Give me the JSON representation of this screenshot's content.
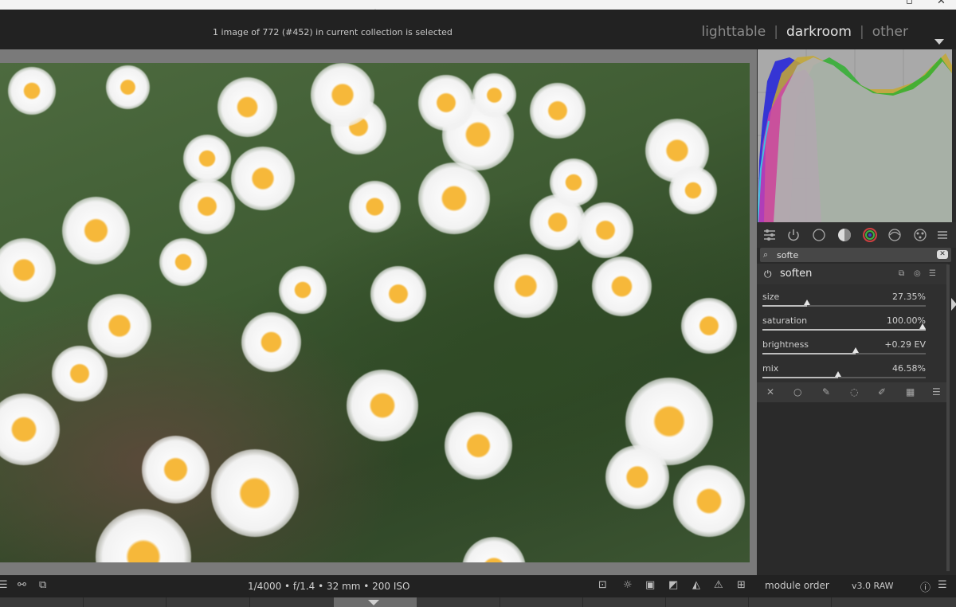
{
  "header": {
    "status": "1 image of 772 (#452) in current collection is selected",
    "views": [
      "lighttable",
      "darkroom",
      "other"
    ],
    "active_view": "darkroom",
    "separator": "|"
  },
  "modules_panel": {
    "search_value": "softe",
    "module": {
      "name": "soften",
      "sliders": [
        {
          "label": "size",
          "value": "27.35%",
          "fraction": 0.2735
        },
        {
          "label": "saturation",
          "value": "100.00%",
          "fraction": 1.0
        },
        {
          "label": "brightness",
          "value": "+0.29 EV",
          "fraction": 0.57
        },
        {
          "label": "mix",
          "value": "46.58%",
          "fraction": 0.4658
        }
      ]
    }
  },
  "footer": {
    "exif": "1/4000 • f/1.4 • 32 mm • 200 ISO",
    "module_order_label": "module order",
    "module_order_value": "v3.0 RAW"
  },
  "colors": {
    "panel_bg": "#2a2a2a",
    "header_bg": "#222222",
    "histogram_bg": "#a9a9a9"
  }
}
